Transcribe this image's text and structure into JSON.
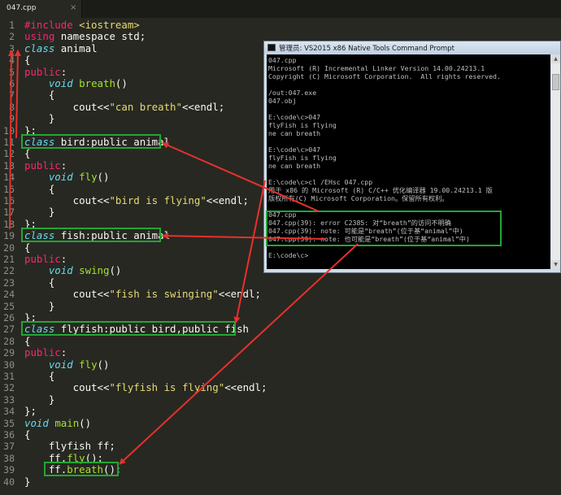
{
  "tab": {
    "filename": "047.cpp",
    "close": "×"
  },
  "colors": {
    "editor_bg": "#272822",
    "keyword": "#f92672",
    "type": "#66d9ef",
    "function": "#a6e22e",
    "string": "#e6db74",
    "highlight_box": "#22a634",
    "arrow": "#e8302c"
  },
  "code": [
    {
      "n": "1",
      "t": [
        {
          "c": "kw",
          "s": "#include "
        },
        {
          "c": "st",
          "s": "<iostream>"
        }
      ]
    },
    {
      "n": "2",
      "t": [
        {
          "c": "kw",
          "s": "using "
        },
        {
          "c": "",
          "s": "namespace std;"
        }
      ]
    },
    {
      "n": "3",
      "t": [
        {
          "c": "ty",
          "s": "class "
        },
        {
          "c": "",
          "s": "animal"
        }
      ]
    },
    {
      "n": "4",
      "t": [
        {
          "c": "",
          "s": "{"
        }
      ]
    },
    {
      "n": "5",
      "t": [
        {
          "c": "kw",
          "s": "public"
        },
        {
          "c": "",
          "s": ":"
        }
      ]
    },
    {
      "n": "6",
      "t": [
        {
          "c": "",
          "s": "    "
        },
        {
          "c": "ty",
          "s": "void "
        },
        {
          "c": "fn",
          "s": "breath"
        },
        {
          "c": "",
          "s": "()"
        }
      ]
    },
    {
      "n": "7",
      "t": [
        {
          "c": "",
          "s": "    {"
        }
      ]
    },
    {
      "n": "8",
      "t": [
        {
          "c": "",
          "s": "        cout<<"
        },
        {
          "c": "st",
          "s": "\"can breath\""
        },
        {
          "c": "",
          "s": "<<endl;"
        }
      ]
    },
    {
      "n": "9",
      "t": [
        {
          "c": "",
          "s": "    }"
        }
      ]
    },
    {
      "n": "10",
      "t": [
        {
          "c": "",
          "s": "};"
        }
      ]
    },
    {
      "n": "11",
      "t": [
        {
          "c": "ty",
          "s": "class "
        },
        {
          "c": "",
          "s": "bird:public animal"
        }
      ]
    },
    {
      "n": "12",
      "t": [
        {
          "c": "",
          "s": "{"
        }
      ]
    },
    {
      "n": "13",
      "t": [
        {
          "c": "kw",
          "s": "public"
        },
        {
          "c": "",
          "s": ":"
        }
      ]
    },
    {
      "n": "14",
      "t": [
        {
          "c": "",
          "s": "    "
        },
        {
          "c": "ty",
          "s": "void "
        },
        {
          "c": "fn",
          "s": "fly"
        },
        {
          "c": "",
          "s": "()"
        }
      ]
    },
    {
      "n": "15",
      "t": [
        {
          "c": "",
          "s": "    {"
        }
      ]
    },
    {
      "n": "16",
      "t": [
        {
          "c": "",
          "s": "        cout<<"
        },
        {
          "c": "st",
          "s": "\"bird is flying\""
        },
        {
          "c": "",
          "s": "<<endl;"
        }
      ]
    },
    {
      "n": "17",
      "t": [
        {
          "c": "",
          "s": "    }"
        }
      ]
    },
    {
      "n": "18",
      "t": [
        {
          "c": "",
          "s": "};"
        }
      ]
    },
    {
      "n": "19",
      "t": [
        {
          "c": "ty",
          "s": "class "
        },
        {
          "c": "",
          "s": "fish:public animal"
        }
      ]
    },
    {
      "n": "20",
      "t": [
        {
          "c": "",
          "s": "{"
        }
      ]
    },
    {
      "n": "21",
      "t": [
        {
          "c": "kw",
          "s": "public"
        },
        {
          "c": "",
          "s": ":"
        }
      ]
    },
    {
      "n": "22",
      "t": [
        {
          "c": "",
          "s": "    "
        },
        {
          "c": "ty",
          "s": "void "
        },
        {
          "c": "fn",
          "s": "swing"
        },
        {
          "c": "",
          "s": "()"
        }
      ]
    },
    {
      "n": "23",
      "t": [
        {
          "c": "",
          "s": "    {"
        }
      ]
    },
    {
      "n": "24",
      "t": [
        {
          "c": "",
          "s": "        cout<<"
        },
        {
          "c": "st",
          "s": "\"fish is swinging\""
        },
        {
          "c": "",
          "s": "<<endl;"
        }
      ]
    },
    {
      "n": "25",
      "t": [
        {
          "c": "",
          "s": "    }"
        }
      ]
    },
    {
      "n": "26",
      "t": [
        {
          "c": "",
          "s": "};"
        }
      ]
    },
    {
      "n": "27",
      "t": [
        {
          "c": "ty",
          "s": "class "
        },
        {
          "c": "",
          "s": "flyfish:public bird,public fish"
        }
      ]
    },
    {
      "n": "28",
      "t": [
        {
          "c": "",
          "s": "{"
        }
      ]
    },
    {
      "n": "29",
      "t": [
        {
          "c": "kw",
          "s": "public"
        },
        {
          "c": "",
          "s": ":"
        }
      ]
    },
    {
      "n": "30",
      "t": [
        {
          "c": "",
          "s": "    "
        },
        {
          "c": "ty",
          "s": "void "
        },
        {
          "c": "fn",
          "s": "fly"
        },
        {
          "c": "",
          "s": "()"
        }
      ]
    },
    {
      "n": "31",
      "t": [
        {
          "c": "",
          "s": "    {"
        }
      ]
    },
    {
      "n": "32",
      "t": [
        {
          "c": "",
          "s": "        cout<<"
        },
        {
          "c": "st",
          "s": "\"flyfish is flying\""
        },
        {
          "c": "",
          "s": "<<endl;"
        }
      ]
    },
    {
      "n": "33",
      "t": [
        {
          "c": "",
          "s": "    }"
        }
      ]
    },
    {
      "n": "34",
      "t": [
        {
          "c": "",
          "s": "};"
        }
      ]
    },
    {
      "n": "35",
      "t": [
        {
          "c": "ty",
          "s": "void "
        },
        {
          "c": "fn",
          "s": "main"
        },
        {
          "c": "",
          "s": "()"
        }
      ]
    },
    {
      "n": "36",
      "t": [
        {
          "c": "",
          "s": "{"
        }
      ]
    },
    {
      "n": "37",
      "t": [
        {
          "c": "",
          "s": "    flyfish ff;"
        }
      ]
    },
    {
      "n": "38",
      "t": [
        {
          "c": "",
          "s": "    ff."
        },
        {
          "c": "fn",
          "s": "fly"
        },
        {
          "c": "",
          "s": "();"
        }
      ]
    },
    {
      "n": "39",
      "t": [
        {
          "c": "",
          "s": "    ff."
        },
        {
          "c": "fn",
          "s": "breath"
        },
        {
          "c": "",
          "s": "();"
        }
      ]
    },
    {
      "n": "40",
      "t": [
        {
          "c": "",
          "s": "}"
        }
      ]
    }
  ],
  "console": {
    "title": "管理员: VS2015 x86 Native Tools Command Prompt",
    "lines": [
      "047.cpp",
      "Microsoft (R) Incremental Linker Version 14.00.24213.1",
      "Copyright (C) Microsoft Corporation.  All rights reserved.",
      "",
      "/out:047.exe",
      "047.obj",
      "",
      "E:\\code\\c>047",
      "flyFish is flying",
      "ne can breath",
      "",
      "E:\\code\\c>047",
      "flyFish is flying",
      "ne can breath",
      "",
      "E:\\code\\c>cl /EHsc 047.cpp",
      "用于 x86 的 Microsoft (R) C/C++ 优化编译器 19.00.24213.1 版",
      "版权所有(C) Microsoft Corporation。保留所有权利。",
      "",
      "047.cpp",
      "047.cpp(39): error C2385: 对“breath”的访问不明确",
      "047.cpp(39): note: 可能是“breath”(位于基“animal”中)",
      "047.cpp(39): note: 也可能是“breath”(位于基“animal”中)",
      "",
      "E:\\code\\c>"
    ]
  }
}
